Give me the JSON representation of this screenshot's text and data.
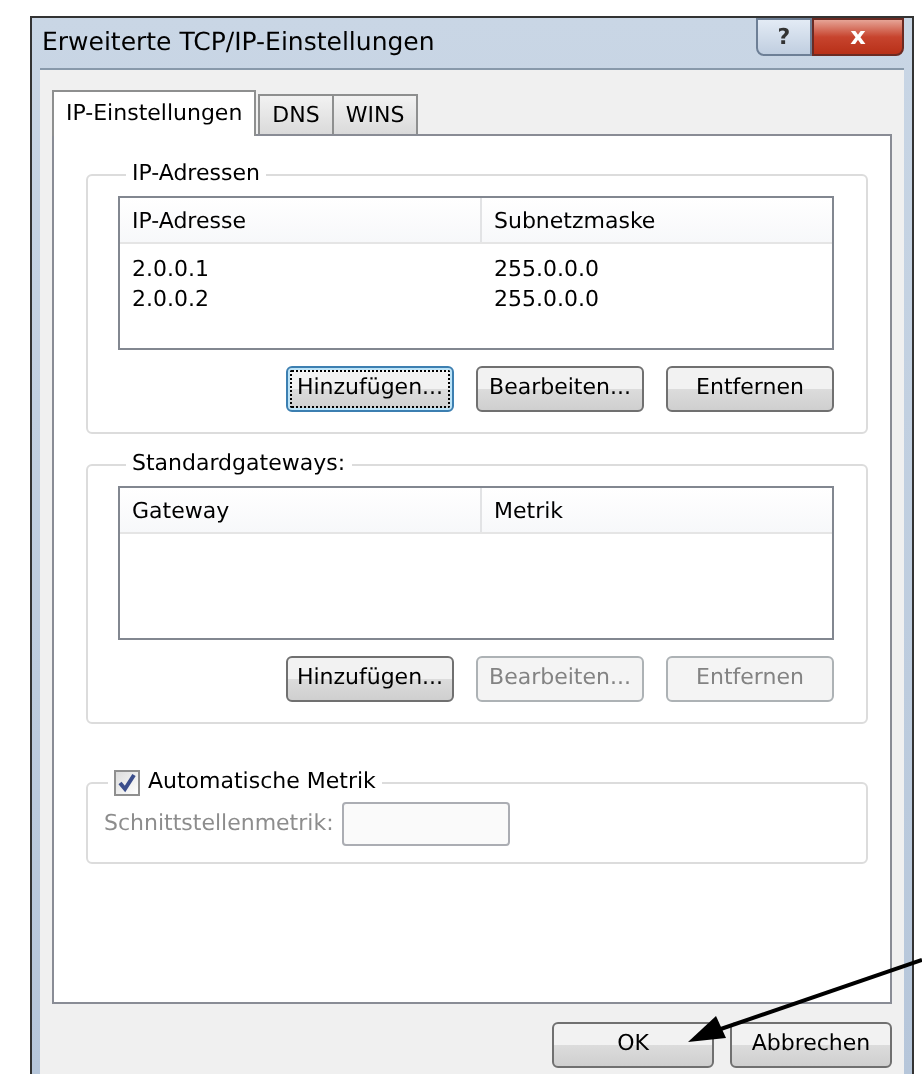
{
  "window": {
    "title": "Erweiterte TCP/IP-Einstellungen",
    "help_button": "?",
    "close_button": "x"
  },
  "tabs": [
    {
      "label": "IP-Einstellungen",
      "selected": true
    },
    {
      "label": "DNS",
      "selected": false
    },
    {
      "label": "WINS",
      "selected": false
    }
  ],
  "groups": [
    {
      "title": "IP-Adressen",
      "columns": [
        "IP-Adresse",
        "Subnetzmaske"
      ],
      "rows": [
        [
          "2.0.0.1",
          "255.0.0.0"
        ],
        [
          "2.0.0.2",
          "255.0.0.0"
        ]
      ],
      "buttons": [
        {
          "label": "Hinzufügen...",
          "disabled": false,
          "focused": true
        },
        {
          "label": "Bearbeiten...",
          "disabled": false,
          "focused": false
        },
        {
          "label": "Entfernen",
          "disabled": false,
          "focused": false
        }
      ]
    },
    {
      "title": "Standardgateways:",
      "columns": [
        "Gateway",
        "Metrik"
      ],
      "buttons": [
        {
          "label": "Hinzufügen...",
          "disabled": false,
          "focused": false
        },
        {
          "label": "Bearbeiten...",
          "disabled": true,
          "focused": false
        },
        {
          "label": "Entfernen",
          "disabled": true,
          "focused": false
        }
      ]
    }
  ],
  "auto_metric": {
    "label": "Automatische Metrik",
    "checked": true
  },
  "interface_metric": {
    "label": "Schnittstellenmetrik:",
    "disabled": true
  },
  "footer_buttons": [
    {
      "label": "OK"
    },
    {
      "label": "Abbrechen"
    }
  ]
}
